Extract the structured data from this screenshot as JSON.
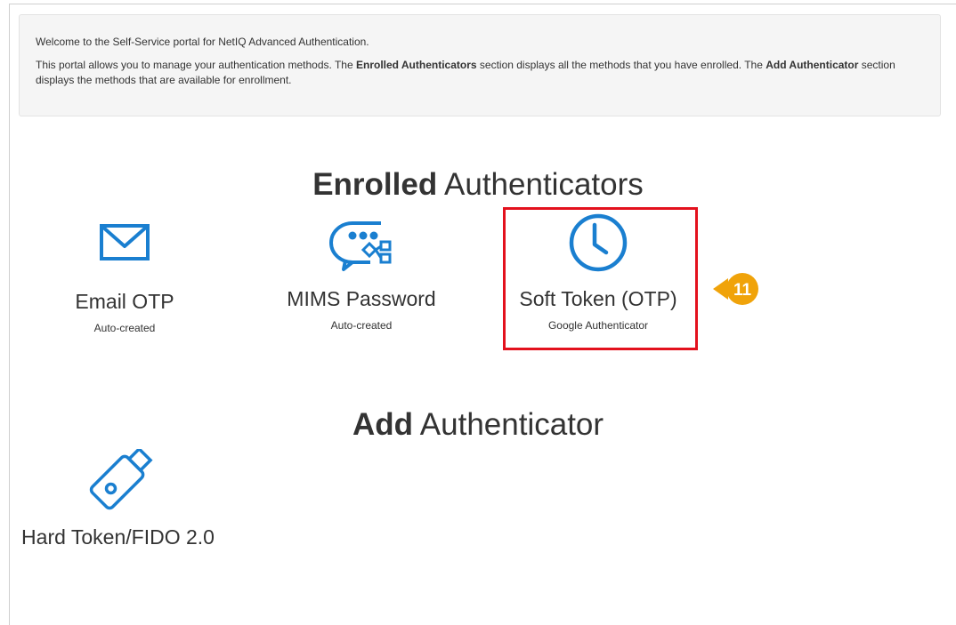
{
  "info": {
    "welcome": "Welcome to the Self-Service portal for NetIQ Advanced Authentication.",
    "desc_part1": "This portal allows you to manage your authentication methods. The ",
    "desc_bold1": "Enrolled Authenticators",
    "desc_part2": " section displays all the methods that you have enrolled. The ",
    "desc_bold2": "Add Authenticator",
    "desc_part3": " section displays the methods that are available for enrollment."
  },
  "enrolled": {
    "title_bold": "Enrolled",
    "title_rest": " Authenticators",
    "items": [
      {
        "name": "Email OTP",
        "sub": "Auto-created",
        "icon": "envelope-icon"
      },
      {
        "name": "MIMS Password",
        "sub": "Auto-created",
        "icon": "password-chat-icon"
      },
      {
        "name": "Soft Token (OTP)",
        "sub": "Google Authenticator",
        "icon": "clock-icon"
      }
    ]
  },
  "add": {
    "title_bold": "Add",
    "title_rest": " Authenticator",
    "items": [
      {
        "name": "Hard Token/FIDO 2.0",
        "icon": "usb-token-icon"
      }
    ]
  },
  "callout": {
    "number": "11",
    "color": "#f0a30a"
  },
  "colors": {
    "accent": "#1a7fd0",
    "highlight": "#e3111d"
  }
}
